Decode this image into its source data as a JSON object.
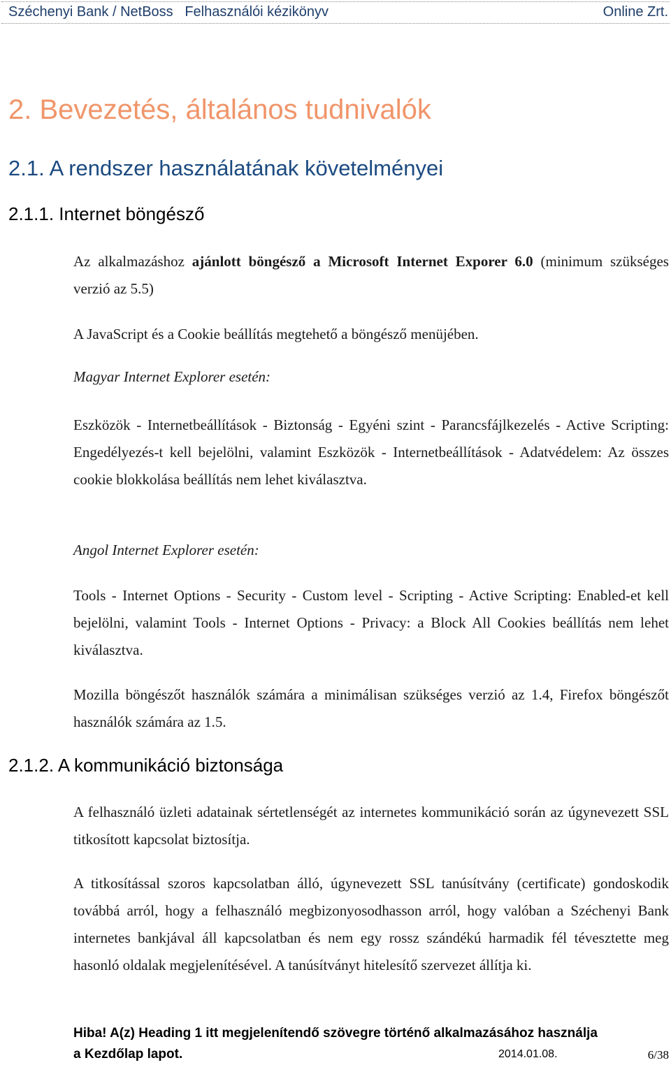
{
  "header": {
    "title": "Széchenyi Bank / NetBoss   Felhasználói kézikönyv",
    "company": "Online Zrt."
  },
  "colors": {
    "header_text": "#1f3e6b",
    "heading1": "#f0956a",
    "heading2": "#1b4a80",
    "body_text": "#1a1a1a"
  },
  "headings": {
    "h1": "2. Bevezetés, általános tudnivalók",
    "h2": "2.1. A rendszer használatának követelményei",
    "h3_browser": "2.1.1. Internet böngésző",
    "h3_security": "2.1.2. A kommunikáció biztonsága"
  },
  "browser_section": {
    "recommended_prefix": "Az alkalmazáshoz ",
    "recommended_bold": "ajánlott böngésző a Microsoft Internet Exporer 6.0",
    "recommended_suffix": " (minimum szükséges verzió az 5.5)",
    "javascript_cookie": "A JavaScript és a Cookie beállítás megtehető a böngésző menüjében.",
    "hungarian_ie_label": "Magyar Internet Explorer esetén:",
    "hungarian_ie_text": "Eszközök - Internetbeállítások - Biztonság - Egyéni szint - Parancsfájlkezelés - Active Scripting: Engedélyezés-t kell bejelölni, valamint Eszközök - Internetbeállítások - Adatvédelem: Az összes cookie blokkolása beállítás nem lehet kiválasztva.",
    "english_ie_label": "Angol Internet Explorer esetén:",
    "english_ie_text": "Tools - Internet Options - Security - Custom level - Scripting - Active Scripting: Enabled-et kell bejelölni, valamint Tools - Internet Options - Privacy: a Block All Cookies beállítás nem lehet kiválasztva.",
    "mozilla_firefox": "Mozilla böngészőt használók számára a minimálisan szükséges verzió az 1.4, Firefox böngészőt használók számára az 1.5."
  },
  "security_section": {
    "para1": "A felhasználó üzleti adatainak sértetlenségét az internetes kommunikáció során az úgynevezett SSL titkosított kapcsolat biztosítja.",
    "para2": "A titkosítással szoros kapcsolatban álló, úgynevezett SSL tanúsítvány (certificate) gondoskodik továbbá arról, hogy a felhasználó megbizonyosodhasson arról, hogy valóban a Széchenyi Bank internetes bankjával áll kapcsolatban és nem egy rossz szándékú harmadik fél tévesztette meg hasonló oldalak megjelenítésével. A tanúsítványt hitelesítő szervezet állítja ki."
  },
  "footer": {
    "error_line1": "Hiba! A(z) Heading 1 itt megjelenítendő szövegre történő alkalmazásához használja",
    "error_line2": "a Kezdőlap lapot.",
    "date": "2014.01.08.",
    "page_indicator": "6/38"
  }
}
